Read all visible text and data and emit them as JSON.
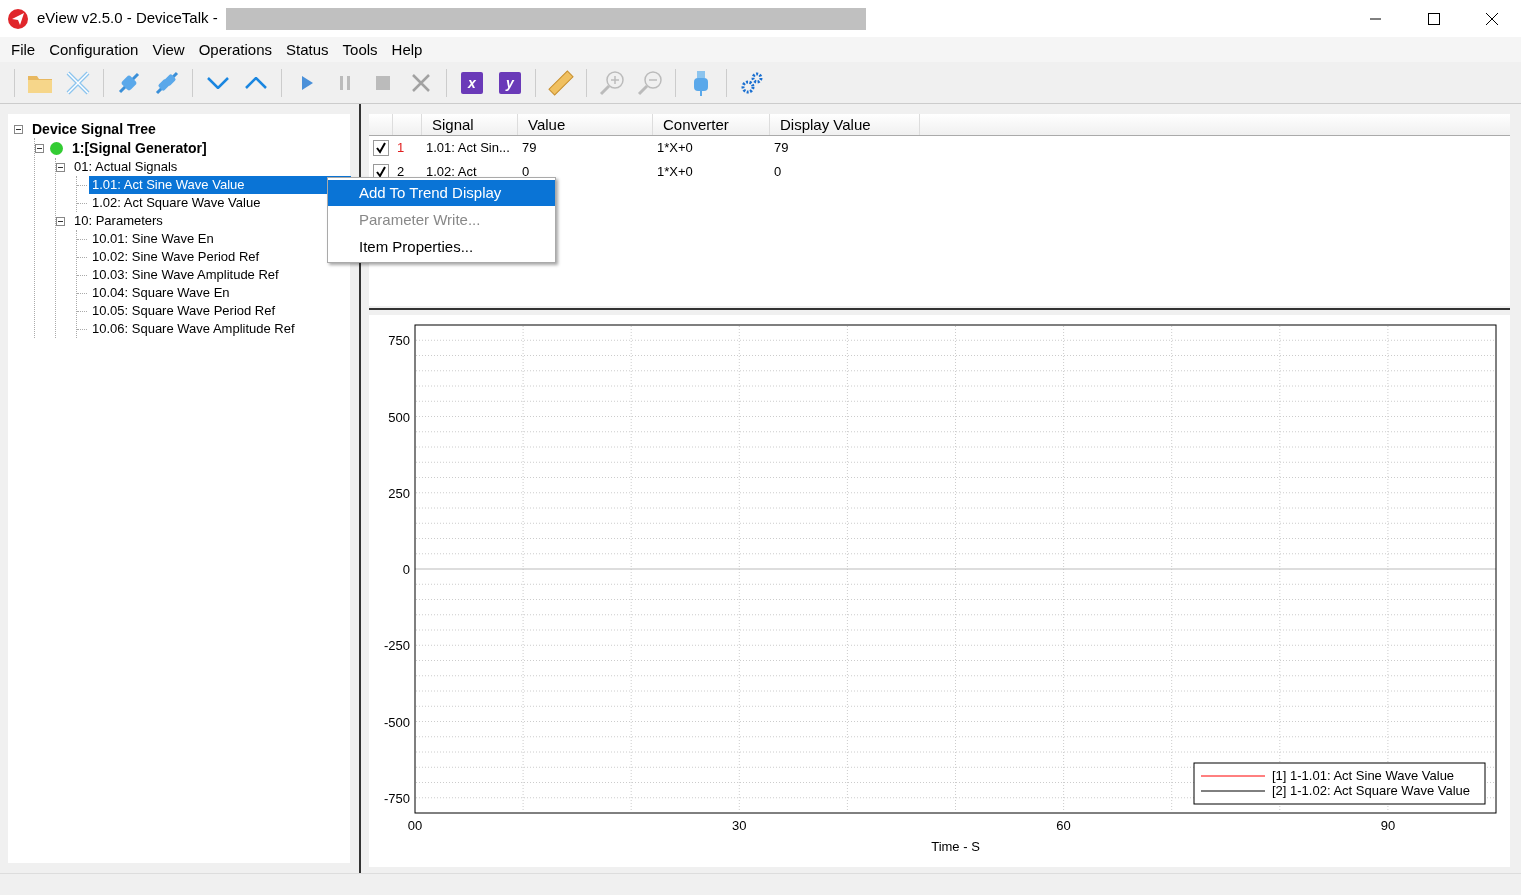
{
  "window": {
    "title": "eView v2.5.0 - DeviceTalk  -"
  },
  "menu": [
    "File",
    "Configuration",
    "View",
    "Operations",
    "Status",
    "Tools",
    "Help"
  ],
  "toolbar": [
    {
      "kind": "folder",
      "disabled": false
    },
    {
      "kind": "close",
      "disabled": false
    },
    {
      "kind": "connect",
      "disabled": false
    },
    {
      "kind": "disconnect",
      "disabled": false
    },
    {
      "kind": "down",
      "disabled": false
    },
    {
      "kind": "up",
      "disabled": false
    },
    {
      "kind": "play",
      "disabled": false
    },
    {
      "kind": "pause",
      "disabled": true
    },
    {
      "kind": "stop",
      "disabled": true
    },
    {
      "kind": "cancel",
      "disabled": true
    },
    {
      "kind": "letter",
      "label": "x",
      "disabled": false
    },
    {
      "kind": "letter",
      "label": "y",
      "disabled": false
    },
    {
      "kind": "ruler",
      "disabled": false
    },
    {
      "kind": "zoomin",
      "disabled": true
    },
    {
      "kind": "zoomout",
      "disabled": true
    },
    {
      "kind": "usb",
      "disabled": false
    },
    {
      "kind": "gears",
      "disabled": false
    }
  ],
  "tree": [
    {
      "label": "Device Signal Tree",
      "kind": "root",
      "expanded": true,
      "selected": false,
      "children": [
        {
          "label": "1:[Signal Generator]",
          "kind": "device",
          "color": "#33cc33",
          "expanded": true,
          "selected": false,
          "children": [
            {
              "label": "01: Actual Signals",
              "kind": "group",
              "expanded": true,
              "selected": false,
              "children": [
                {
                  "label": "1.01: Act Sine Wave Value",
                  "kind": "signal",
                  "selected": true
                },
                {
                  "label": "1.02: Act Square Wave Value",
                  "kind": "signal",
                  "selected": false
                }
              ]
            },
            {
              "label": "10: Parameters",
              "kind": "group",
              "expanded": true,
              "selected": false,
              "children": [
                {
                  "label": "10.01: Sine Wave En",
                  "kind": "signal",
                  "selected": false
                },
                {
                  "label": "10.02: Sine Wave Period Ref",
                  "kind": "signal",
                  "selected": false
                },
                {
                  "label": "10.03: Sine Wave Amplitude Ref",
                  "kind": "signal",
                  "selected": false
                },
                {
                  "label": "10.04: Square Wave En",
                  "kind": "signal",
                  "selected": false
                },
                {
                  "label": "10.05: Square Wave Period Ref",
                  "kind": "signal",
                  "selected": false
                },
                {
                  "label": "10.06: Square Wave Amplitude Ref",
                  "kind": "signal",
                  "selected": false
                }
              ]
            }
          ]
        }
      ]
    }
  ],
  "table": {
    "columns": [
      "Signal",
      "Value",
      "Converter",
      "Display Value"
    ],
    "rows": [
      {
        "checked": true,
        "index": "1",
        "color": "#e02020",
        "signal": "1.01: Act Sin...",
        "value": "79",
        "converter": "1*X+0",
        "display_value": "79"
      },
      {
        "checked": true,
        "index": "2",
        "color": "#000000",
        "signal": "1.02: Act",
        "value": "0",
        "converter": "1*X+0",
        "display_value": "0"
      }
    ]
  },
  "context_menu": [
    {
      "label": "Add To Trend Display",
      "selected": true,
      "disabled": false
    },
    {
      "label": "Parameter Write...",
      "selected": false,
      "disabled": true
    },
    {
      "label": "Item Properties...",
      "selected": false,
      "disabled": false
    }
  ],
  "trend": {
    "chart_data": {
      "type": "line",
      "xlabel": "Time - S",
      "categories": [
        "00",
        "30",
        "60",
        "90"
      ],
      "ylim": [
        -800,
        800
      ],
      "grid": true,
      "yticks": [
        750,
        500,
        250,
        0,
        -250,
        -500,
        -750
      ],
      "series": [
        {
          "name": "[1] 1-1.01: Act Sine Wave Value",
          "color": "#ff0000",
          "values": [
            null,
            null,
            null,
            null
          ]
        },
        {
          "name": "[2] 1-1.02: Act Square Wave Value",
          "color": "#000000",
          "values": [
            null,
            null,
            null,
            null
          ]
        }
      ]
    }
  }
}
